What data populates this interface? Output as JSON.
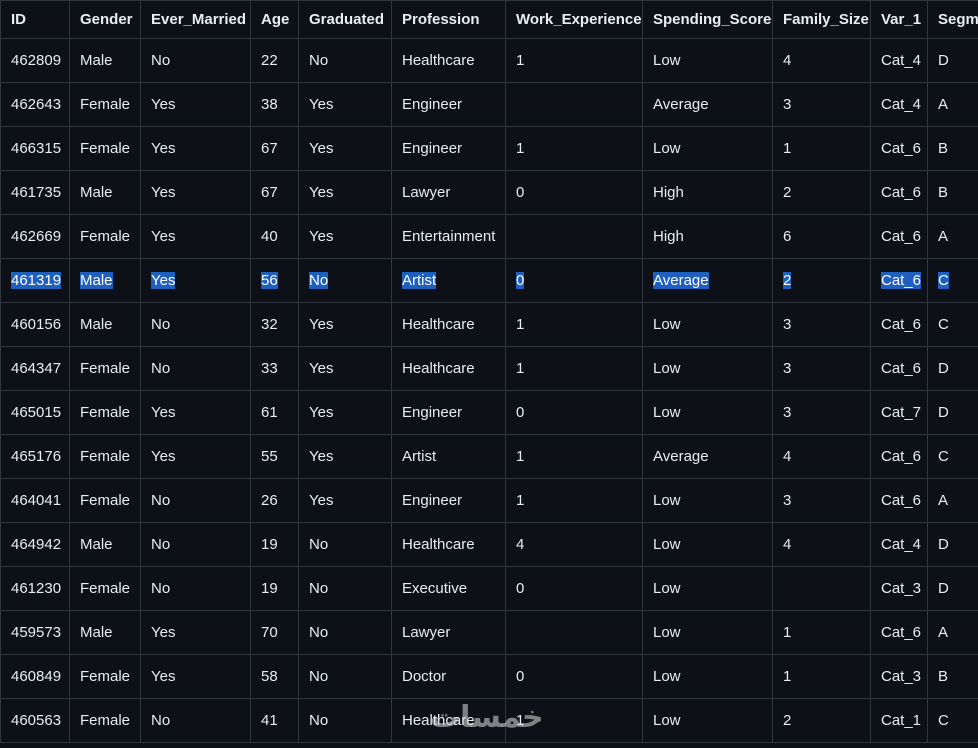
{
  "table": {
    "columns": [
      "ID",
      "Gender",
      "Ever_Married",
      "Age",
      "Graduated",
      "Profession",
      "Work_Experience",
      "Spending_Score",
      "Family_Size",
      "Var_1",
      "Segmentation"
    ],
    "selected_row": 5,
    "rows": [
      [
        "462809",
        "Male",
        "No",
        "22",
        "No",
        "Healthcare",
        "1",
        "Low",
        "4",
        "Cat_4",
        "D"
      ],
      [
        "462643",
        "Female",
        "Yes",
        "38",
        "Yes",
        "Engineer",
        "",
        "Average",
        "3",
        "Cat_4",
        "A"
      ],
      [
        "466315",
        "Female",
        "Yes",
        "67",
        "Yes",
        "Engineer",
        "1",
        "Low",
        "1",
        "Cat_6",
        "B"
      ],
      [
        "461735",
        "Male",
        "Yes",
        "67",
        "Yes",
        "Lawyer",
        "0",
        "High",
        "2",
        "Cat_6",
        "B"
      ],
      [
        "462669",
        "Female",
        "Yes",
        "40",
        "Yes",
        "Entertainment",
        "",
        "High",
        "6",
        "Cat_6",
        "A"
      ],
      [
        "461319",
        "Male",
        "Yes",
        "56",
        "No",
        "Artist",
        "0",
        "Average",
        "2",
        "Cat_6",
        "C"
      ],
      [
        "460156",
        "Male",
        "No",
        "32",
        "Yes",
        "Healthcare",
        "1",
        "Low",
        "3",
        "Cat_6",
        "C"
      ],
      [
        "464347",
        "Female",
        "No",
        "33",
        "Yes",
        "Healthcare",
        "1",
        "Low",
        "3",
        "Cat_6",
        "D"
      ],
      [
        "465015",
        "Female",
        "Yes",
        "61",
        "Yes",
        "Engineer",
        "0",
        "Low",
        "3",
        "Cat_7",
        "D"
      ],
      [
        "465176",
        "Female",
        "Yes",
        "55",
        "Yes",
        "Artist",
        "1",
        "Average",
        "4",
        "Cat_6",
        "C"
      ],
      [
        "464041",
        "Female",
        "No",
        "26",
        "Yes",
        "Engineer",
        "1",
        "Low",
        "3",
        "Cat_6",
        "A"
      ],
      [
        "464942",
        "Male",
        "No",
        "19",
        "No",
        "Healthcare",
        "4",
        "Low",
        "4",
        "Cat_4",
        "D"
      ],
      [
        "461230",
        "Female",
        "No",
        "19",
        "No",
        "Executive",
        "0",
        "Low",
        "",
        "Cat_3",
        "D"
      ],
      [
        "459573",
        "Male",
        "Yes",
        "70",
        "No",
        "Lawyer",
        "",
        "Low",
        "1",
        "Cat_6",
        "A"
      ],
      [
        "460849",
        "Female",
        "Yes",
        "58",
        "No",
        "Doctor",
        "0",
        "Low",
        "1",
        "Cat_3",
        "B"
      ],
      [
        "460563",
        "Female",
        "No",
        "41",
        "No",
        "Healthcare",
        "1",
        "Low",
        "2",
        "Cat_1",
        "C"
      ]
    ]
  },
  "watermark": "خمسات"
}
